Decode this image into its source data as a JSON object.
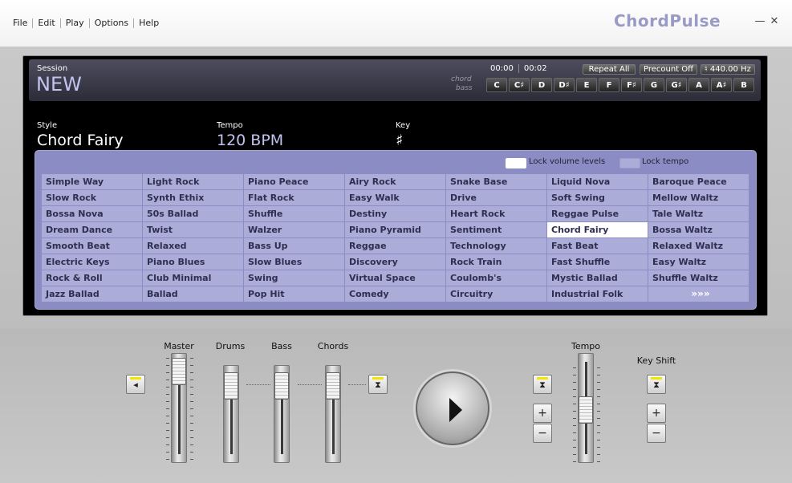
{
  "menu": [
    "File",
    "Edit",
    "Play",
    "Options",
    "Help"
  ],
  "app_title": "ChordPulse",
  "window": {
    "minimize": "—",
    "close": "✕"
  },
  "session": {
    "label": "Session",
    "name": "NEW"
  },
  "time": {
    "elapsed": "00:00",
    "total": "00:02"
  },
  "toggles": {
    "repeat": "Repeat All",
    "precount": "Precount Off",
    "tuning": "♮ 440.00 Hz"
  },
  "rows": {
    "chord": "chord",
    "bass": "bass"
  },
  "keys": [
    "C",
    "C♯",
    "D",
    "D♯",
    "E",
    "F",
    "F♯",
    "G",
    "G♯",
    "A",
    "A♯",
    "B"
  ],
  "style": {
    "label": "Style",
    "value": "Chord Fairy"
  },
  "tempo": {
    "label": "Tempo",
    "value": "120 BPM"
  },
  "key": {
    "label": "Key",
    "value": "♯"
  },
  "locks": {
    "volume": "Lock volume levels",
    "tempo": "Lock tempo",
    "volume_color": "#ffffff",
    "tempo_color": "#acacd9"
  },
  "styles": [
    [
      "Simple Way",
      "Light Rock",
      "Piano Peace",
      "Airy Rock",
      "Snake Base",
      "Liquid Nova",
      "Baroque Peace"
    ],
    [
      "Slow Rock",
      "Synth Ethix",
      "Flat Rock",
      "Easy Walk",
      "Drive",
      "Soft Swing",
      "Mellow Waltz"
    ],
    [
      "Bossa Nova",
      "50s Ballad",
      "Shuffle",
      "Destiny",
      "Heart Rock",
      "Reggae Pulse",
      "Tale Waltz"
    ],
    [
      "Dream Dance",
      "Twist",
      "Walzer",
      "Piano Pyramid",
      "Sentiment",
      "Chord Fairy",
      "Bossa Waltz"
    ],
    [
      "Smooth Beat",
      "Relaxed",
      "Bass Up",
      "Reggae",
      "Technology",
      "Fast Beat",
      "Relaxed Waltz"
    ],
    [
      "Electric Keys",
      "Piano Blues",
      "Slow Blues",
      "Discovery",
      "Rock Train",
      "Fast Shuffle",
      "Easy Waltz"
    ],
    [
      "Rock & Roll",
      "Club Minimal",
      "Swing",
      "Virtual Space",
      "Coulomb's",
      "Mystic Ballad",
      "Shuffle Waltz"
    ],
    [
      "Jazz Ballad",
      "Ballad",
      "Pop Hit",
      "Comedy",
      "Circuitry",
      "Industrial Folk",
      "»»»"
    ]
  ],
  "selected_style": "Chord Fairy",
  "sliders": {
    "master": "Master",
    "drums": "Drums",
    "bass": "Bass",
    "chords": "Chords",
    "tempo": "Tempo",
    "keyshift": "Key Shift"
  },
  "buttons": {
    "plus": "+",
    "minus": "−"
  },
  "colors": {
    "accent": "#c3c3f0",
    "panel": "#8c8cc4",
    "cell": "#acacd9",
    "led": "#f0e600"
  }
}
